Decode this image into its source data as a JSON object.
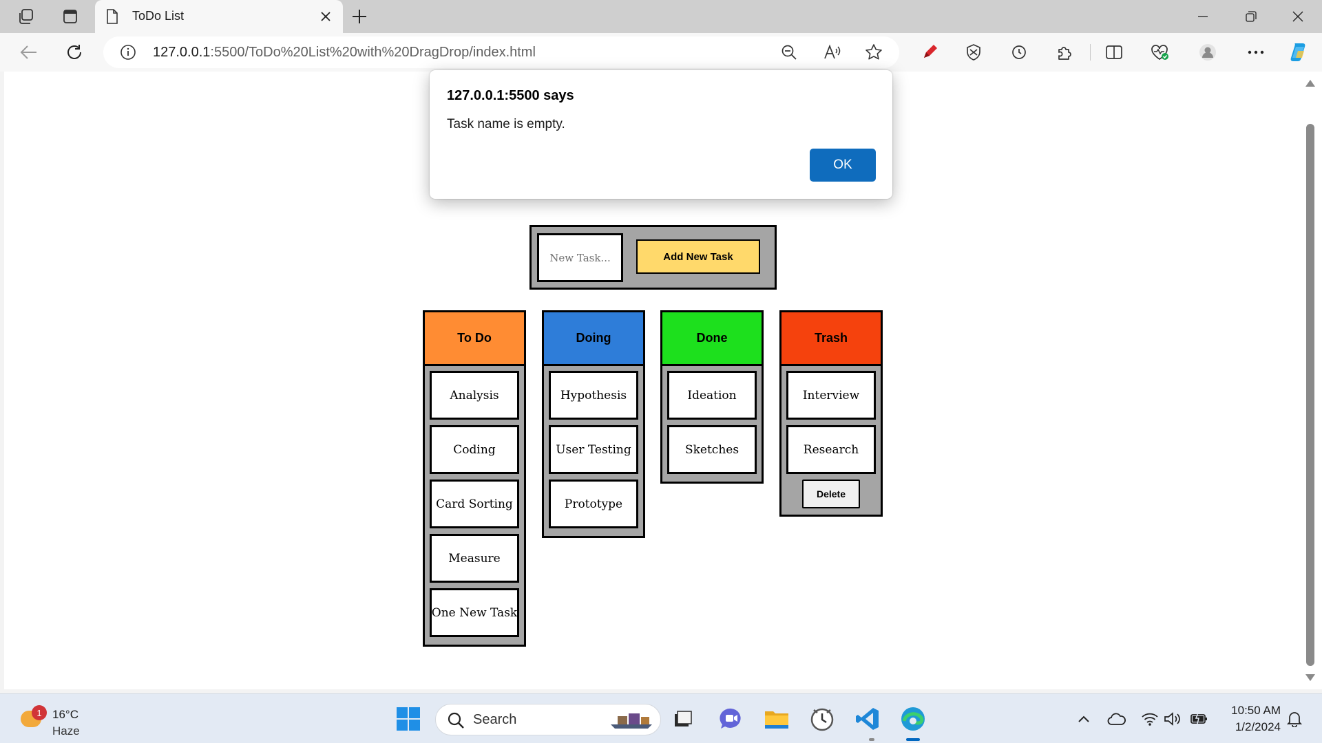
{
  "browser": {
    "tab": {
      "title": "ToDo List"
    },
    "address": {
      "host": "127.0.0.1",
      "path": ":5500/ToDo%20List%20with%20DragDrop/index.html"
    }
  },
  "alert": {
    "title": "127.0.0.1:5500 says",
    "message": "Task name is empty.",
    "ok_label": "OK"
  },
  "app": {
    "input": {
      "placeholder": "New Task..."
    },
    "add_button_label": "Add New Task",
    "columns": [
      {
        "title": "To Do",
        "color": "#ff8c33",
        "tasks": [
          "Analysis",
          "Coding",
          "Card Sorting",
          "Measure",
          "One New Task"
        ]
      },
      {
        "title": "Doing",
        "color": "#2e7dd9",
        "tasks": [
          "Hypothesis",
          "User Testing",
          "Prototype"
        ]
      },
      {
        "title": "Done",
        "color": "#1de01d",
        "tasks": [
          "Ideation",
          "Sketches"
        ]
      },
      {
        "title": "Trash",
        "color": "#f5420d",
        "tasks": [
          "Interview",
          "Research"
        ]
      }
    ],
    "delete_button_label": "Delete"
  },
  "taskbar": {
    "weather": {
      "temp": "16°C",
      "condition": "Haze",
      "badge": "1"
    },
    "search_placeholder": "Search",
    "clock": {
      "time": "10:50 AM",
      "date": "1/2/2024"
    }
  },
  "icons": {
    "tabbar": [
      "workspaces-icon",
      "tab-actions-icon"
    ],
    "toolbar_right": [
      "zoom-out-icon",
      "read-aloud-icon",
      "favorite-star-icon",
      "pen-extension-icon",
      "extension-shield-icon",
      "history-icon",
      "extensions-puzzle-icon",
      "split-screen-icon",
      "browser-essentials-icon",
      "profile-icon",
      "more-menu-icon",
      "copilot-icon"
    ],
    "taskbar_apps": [
      "windows-start-icon",
      "task-view-icon",
      "teams-chat-icon",
      "file-explorer-icon",
      "clock-app-icon",
      "vscode-icon",
      "edge-icon"
    ],
    "tray": [
      "show-hidden-icons-chevron",
      "onedrive-cloud-icon",
      "wifi-icon",
      "volume-icon",
      "battery-icon",
      "notification-bell-icon"
    ]
  }
}
